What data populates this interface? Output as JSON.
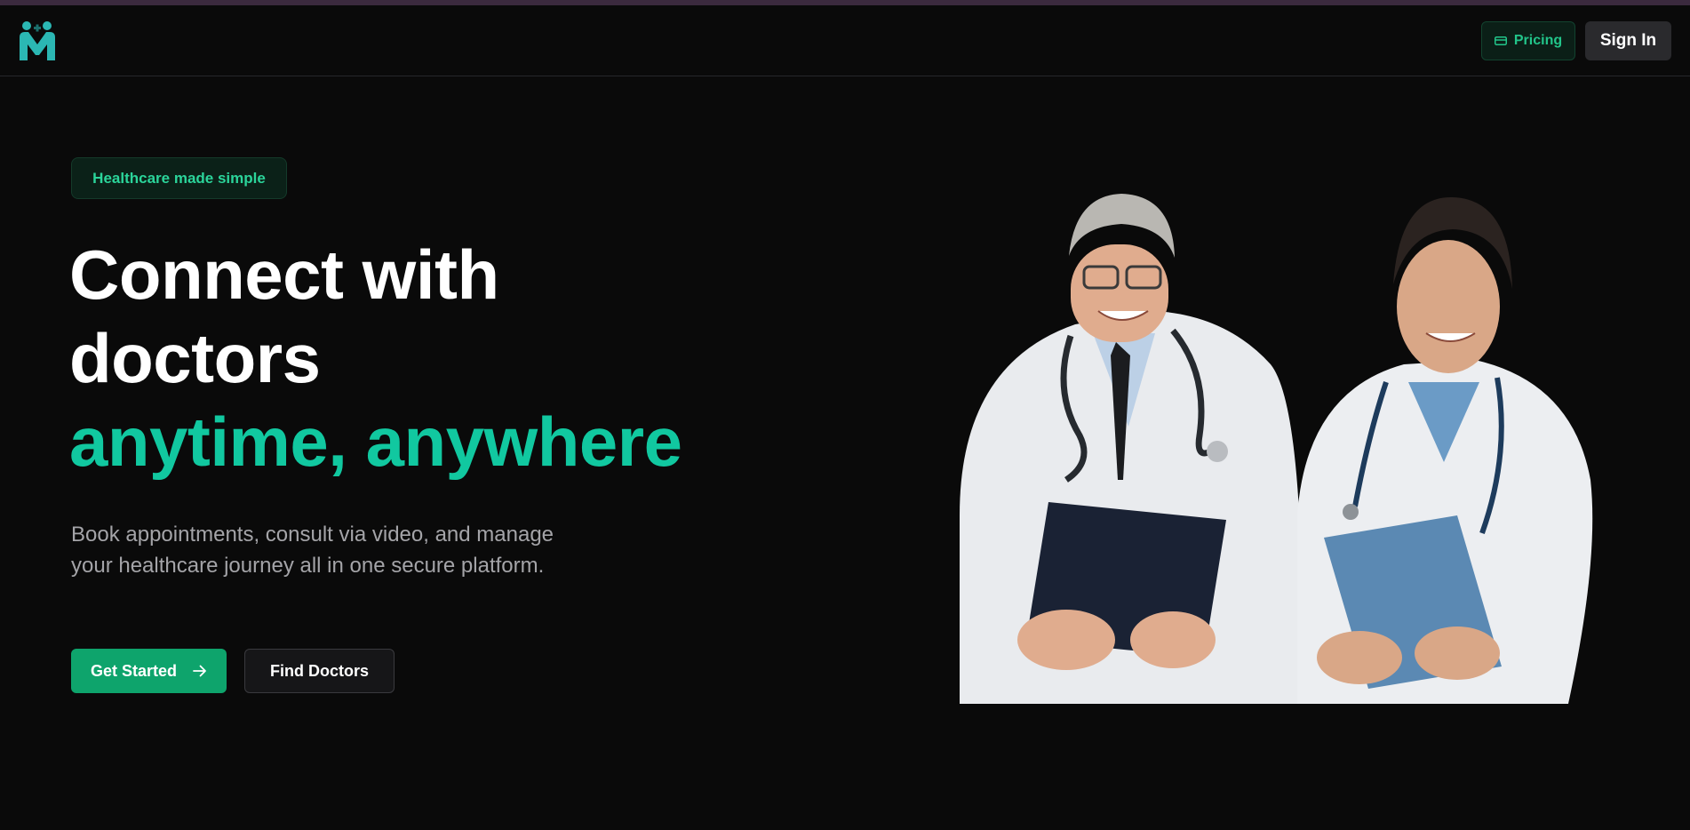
{
  "header": {
    "logo_icon": "medical-people-logo",
    "pricing_label": "Pricing",
    "pricing_icon": "credit-card-icon",
    "signin_label": "Sign In"
  },
  "hero": {
    "badge": "Healthcare made simple",
    "headline_line1": "Connect with",
    "headline_line2": "doctors",
    "headline_accent": "anytime, anywhere",
    "description": "Book appointments, consult via video, and manage your healthcare journey all in one secure platform.",
    "primary_cta": "Get Started",
    "secondary_cta": "Find Doctors",
    "image_alt": "Two smiling doctors in white coats holding clipboards"
  },
  "colors": {
    "background": "#0a0a0a",
    "accent": "#11c8a0",
    "primary_button": "#0ea46c",
    "badge_text": "#2bd49a"
  }
}
